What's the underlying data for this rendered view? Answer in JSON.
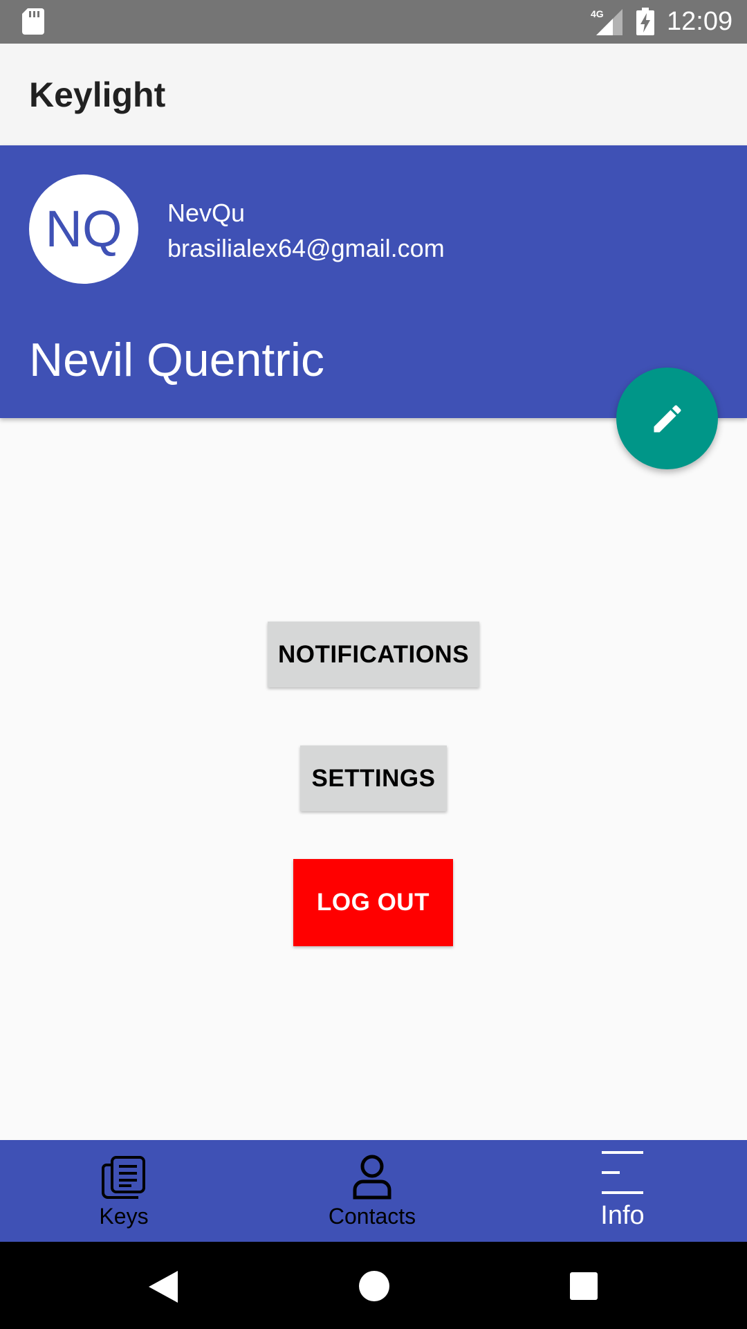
{
  "status_bar": {
    "time": "12:09",
    "network": "4G",
    "icons": [
      "sd-card-icon",
      "signal-icon",
      "battery-charging-icon"
    ]
  },
  "app_bar": {
    "title": "Keylight"
  },
  "profile": {
    "initials": "NQ",
    "username": "NevQu",
    "email": "brasilialex64@gmail.com",
    "full_name": "Nevil Quentric"
  },
  "fab": {
    "icon": "pencil-icon"
  },
  "actions": {
    "notifications_label": "NOTIFICATIONS",
    "settings_label": "SETTINGS",
    "logout_label": "LOG OUT"
  },
  "bottom_nav": {
    "items": [
      {
        "label": "Keys",
        "icon": "keys-icon"
      },
      {
        "label": "Contacts",
        "icon": "person-icon"
      },
      {
        "label": "Info",
        "icon": "menu-lines-icon",
        "selected": true
      }
    ]
  },
  "colors": {
    "primary": "#3f51b5",
    "fab": "#009688",
    "logout": "#ff0000",
    "status_bar": "#757575",
    "app_bar": "#f5f5f5",
    "background": "#fafafa",
    "button_gray": "#d6d7d7"
  }
}
